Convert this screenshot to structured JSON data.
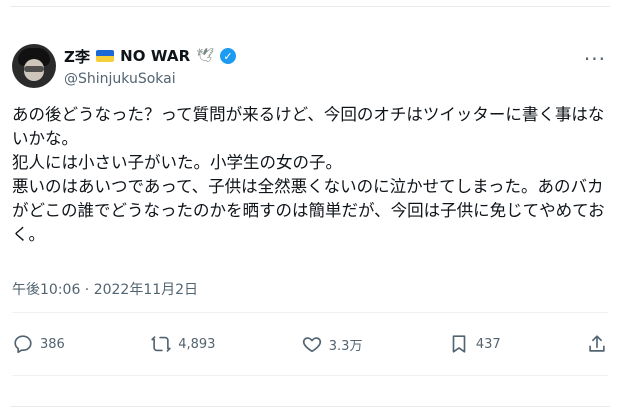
{
  "user": {
    "display_name": "Z李",
    "badge_text": "NO WAR",
    "handle": "@ShinjukuSokai",
    "dove_icon": "🕊",
    "verified_check": "✓",
    "avatar_desc": "avatar-photo"
  },
  "menu": {
    "more_label": "···"
  },
  "tweet": {
    "lines": [
      "あの後どうなった？って質問が来るけど、今回のオチはツイッターに書く事はないかな。",
      "犯人には小さい子がいた。小学生の女の子。",
      "悪いのはあいつであって、子供は全然悪くないのに泣かせてしまった。あのバカがどこの誰でどうなったのかを晒すのは簡単だが、今回は子供に免じてやめておく。"
    ],
    "timestamp": "午後10:06 · 2022年11月2日"
  },
  "actions": {
    "reply_count": "386",
    "retweet_count": "4,893",
    "like_count": "3.3万",
    "bookmark_count": "437"
  },
  "colors": {
    "text_primary": "#0f1419",
    "text_secondary": "#536471",
    "verified_blue": "#1d9bf0",
    "flag_blue": "#1b68d6",
    "flag_yellow": "#f6cf3a"
  }
}
